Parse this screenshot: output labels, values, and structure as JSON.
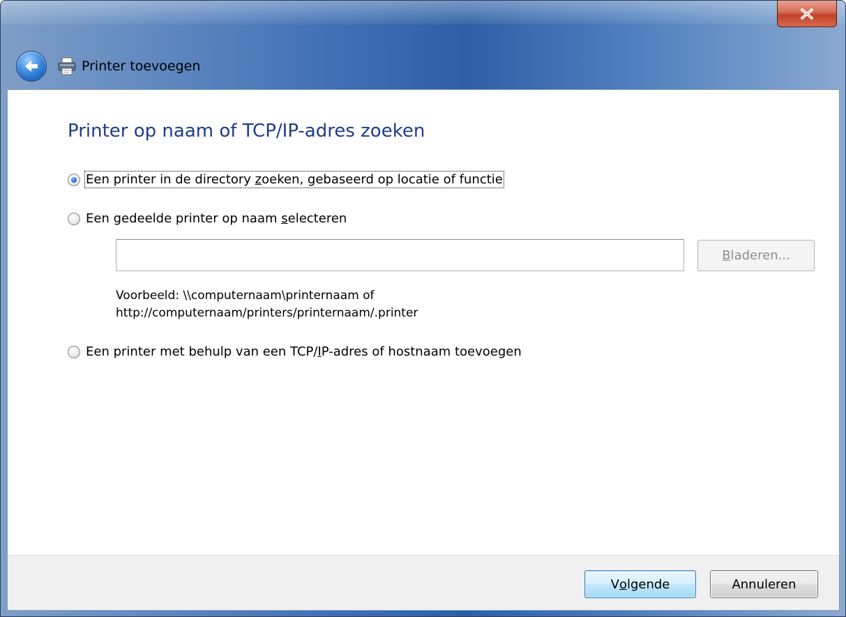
{
  "window": {
    "title": "Printer toevoegen",
    "close_symbol": "✕"
  },
  "icons": {
    "back": "back-arrow-icon",
    "printer": "printer-icon",
    "close": "close-icon"
  },
  "heading": "Printer op naam of TCP/IP-adres zoeken",
  "options": [
    {
      "pre": "Een printer in de directory ",
      "key": "z",
      "post": "oeken, gebaseerd op locatie of functie",
      "selected": true
    },
    {
      "pre": "Een gedeelde printer op naam ",
      "key": "s",
      "post": "electeren",
      "selected": false
    },
    {
      "pre": "Een printer met behulp van een TCP/",
      "key": "I",
      "post": "P-adres of hostnaam toevoegen",
      "selected": false
    }
  ],
  "shared_printer": {
    "value": "",
    "placeholder": "",
    "browse": {
      "key": "B",
      "rest": "laderen..."
    },
    "example_line1": "Voorbeeld: \\\\computernaam\\printernaam of",
    "example_line2": "http://computernaam/printers/printernaam/.printer"
  },
  "footer": {
    "next": {
      "pre": "V",
      "key": "o",
      "post": "lgende"
    },
    "cancel": "Annuleren"
  },
  "colors": {
    "heading": "#1e3c8c",
    "close_button": "#c1412a",
    "footer_bg": "#f0f0f0"
  }
}
